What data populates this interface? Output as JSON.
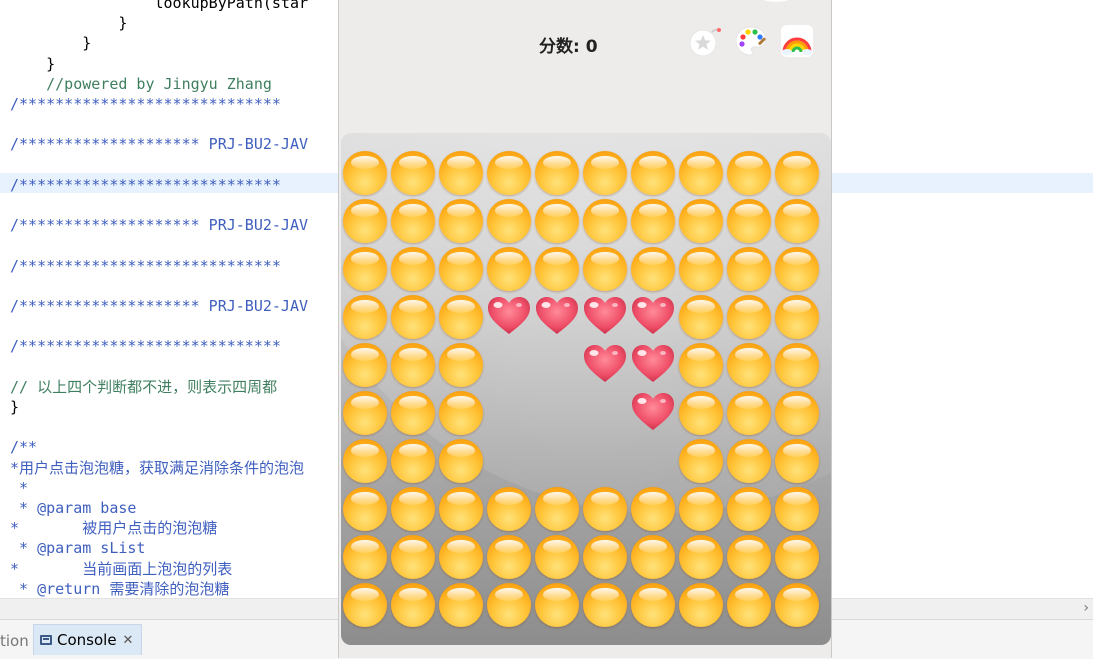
{
  "editor": {
    "lines": [
      {
        "indent": "                ",
        "text": "lookupByPath(star",
        "kind": "code"
      },
      {
        "indent": "            ",
        "text": "}",
        "kind": "code"
      },
      {
        "indent": "        ",
        "text": "}",
        "kind": "code"
      },
      {
        "indent": "    ",
        "text": "}",
        "kind": "code"
      },
      {
        "indent": "    ",
        "text": "//powered by Jingyu Zhang",
        "kind": "comment"
      },
      {
        "indent": "",
        "text": "/*****************************",
        "kind": "doc"
      },
      {
        "indent": "",
        "text": "",
        "kind": "blank"
      },
      {
        "indent": "",
        "text": "/******************** PRJ-BU2-JAV",
        "kind": "doc"
      },
      {
        "indent": "",
        "text": "",
        "kind": "blank"
      },
      {
        "indent": "",
        "text": "/*****************************",
        "kind": "doc"
      },
      {
        "indent": "",
        "text": "",
        "kind": "blank"
      },
      {
        "indent": "",
        "text": "/******************** PRJ-BU2-JAV",
        "kind": "doc"
      },
      {
        "indent": "",
        "text": "",
        "kind": "blank"
      },
      {
        "indent": "",
        "text": "/*****************************",
        "kind": "doc"
      },
      {
        "indent": "",
        "text": "",
        "kind": "blank"
      },
      {
        "indent": "",
        "text": "/******************** PRJ-BU2-JAV",
        "kind": "doc"
      },
      {
        "indent": "",
        "text": "",
        "kind": "blank"
      },
      {
        "indent": "",
        "text": "/*****************************",
        "kind": "doc"
      },
      {
        "indent": "",
        "text": "",
        "kind": "blank"
      },
      {
        "indent": "",
        "text": "// 以上四个判断都不进，则表示四周都",
        "kind": "comment"
      },
      {
        "indent": "",
        "text": "}",
        "kind": "code"
      },
      {
        "indent": "",
        "text": "",
        "kind": "blank"
      },
      {
        "indent": "",
        "text": "/**",
        "kind": "doc"
      },
      {
        "indent": "",
        "text": "*用户点击泡泡糖，获取满足消除条件的泡泡",
        "kind": "doc"
      },
      {
        "indent": "",
        "text": " *",
        "kind": "doc"
      },
      {
        "indent": "",
        "text": " * @param base",
        "kind": "doc"
      },
      {
        "indent": "",
        "text": "*       被用户点击的泡泡糖",
        "kind": "doc"
      },
      {
        "indent": "",
        "text": " * @param sList",
        "kind": "doc"
      },
      {
        "indent": "",
        "text": "*       当前画面上泡泡的列表",
        "kind": "doc"
      },
      {
        "indent": "",
        "text": " * @return 需要清除的泡泡糖",
        "kind": "doc"
      }
    ],
    "hscroll_arrow": "›"
  },
  "bottom_tabs": {
    "previous_tab_fragment": "tion",
    "console_label": "Console",
    "close_glyph": "✕"
  },
  "game": {
    "score_label": "分数: 0",
    "tools": [
      {
        "name": "bomb-star-tool",
        "icon": "bomb-star-icon"
      },
      {
        "name": "palette-tool",
        "icon": "palette-icon"
      },
      {
        "name": "rainbow-tool",
        "icon": "rainbow-icon"
      }
    ],
    "board": {
      "columns": 10,
      "rows": 10,
      "legend": {
        "O": "orange-candy",
        "H": "heart",
        ".": "empty"
      },
      "grid": [
        "OOOOOOOOOO",
        "OOOOOOOOOO",
        "OOOOOOOOOO",
        "OOOHHHHOOO",
        "OOO..HHOOO",
        "OOO...HOOO",
        "OOO....OOO",
        "OOOOOOOOOO",
        "OOOOOOOOOO",
        "OOOOOOOOOO"
      ]
    },
    "colors": {
      "candy_orange": "#fdaa17",
      "heart_red": "#f0506a",
      "board_top": "#dcdcdc",
      "board_bottom": "#8d8d8d",
      "window_bg": "#edecea"
    }
  }
}
